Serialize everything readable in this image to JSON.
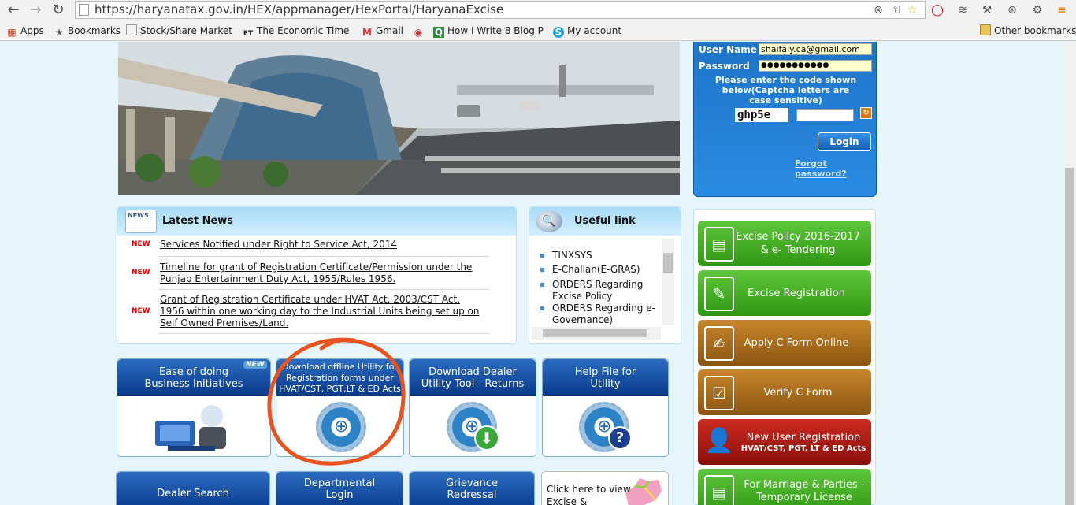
{
  "browser": {
    "url": "https://haryanatax.gov.in/HEX/appmanager/HexPortal/HaryanaExcise",
    "bookmarks": [
      {
        "label": "Apps",
        "icon": "apps-grid-icon"
      },
      {
        "label": "Bookmarks",
        "icon": "star-icon"
      },
      {
        "label": "Stock/Share Market Ir",
        "icon": "page-icon"
      },
      {
        "label": "The Economic Times:",
        "icon": "et-icon"
      },
      {
        "label": "Gmail",
        "icon": "gmail-icon"
      },
      {
        "label": "",
        "icon": "site-icon"
      },
      {
        "label": "How I Write 8 Blog Po",
        "icon": "quora-icon"
      },
      {
        "label": "My account",
        "icon": "skype-icon"
      }
    ],
    "other_bookmarks": "Other bookmarks"
  },
  "login": {
    "username_label": "User Name",
    "username_value": "shaifaly.ca@gmail.com",
    "password_label": "Password",
    "password_value": "●●●●●●●●●●●",
    "captcha_instructions": "Please enter the code shown below(Captcha letters are case sensitive)",
    "captcha_code": "ghp5e",
    "login_label": "Login",
    "forgot_label": "Forgot password?"
  },
  "latest_news": {
    "title": "Latest News",
    "new_tag": "NEW",
    "items": [
      "Services Notified under Right to Service Act, 2014",
      "Timeline for grant of Registration Certificate/Permission under the Punjab Entertainment Duty Act, 1955/Rules 1956.",
      "Grant of Registration Certificate under HVAT Act, 2003/CST Act, 1956 within one working day to the Industrial Units being set up on Self Owned Premises/Land."
    ]
  },
  "useful_link": {
    "title": "Useful link",
    "items": [
      "TINXSYS",
      "E-Challan(E-GRAS)",
      "ORDERS Regarding Excise Policy",
      "ORDERS Regarding e-Governance)"
    ]
  },
  "tiles": {
    "ease": "Ease of doing Business Initiatives",
    "ease_badge": "NEW",
    "offline": "Download offline Utility for Registration forms under HVAT/CST, PGT,LT & ED Acts",
    "dealer_utility": "Download Dealer Utility Tool - Returns",
    "help_file": "Help File for Utility",
    "dealer_search": "Dealer Search",
    "departmental": "Departmental Login",
    "grievance": "Grievance Redressal",
    "map_text": "Click here to view Excise &"
  },
  "menu": {
    "policy": "Excise Policy 2016-2017 & e- Tendering",
    "registration": "Excise Registration",
    "apply_c": "Apply C Form Online",
    "verify_c": "Verify C Form",
    "new_user": "New User Registration",
    "new_user_sub": "HVAT/CST, PGT, LT & ED Acts",
    "marriage": "For Marriage & Parties - Temporary License"
  }
}
